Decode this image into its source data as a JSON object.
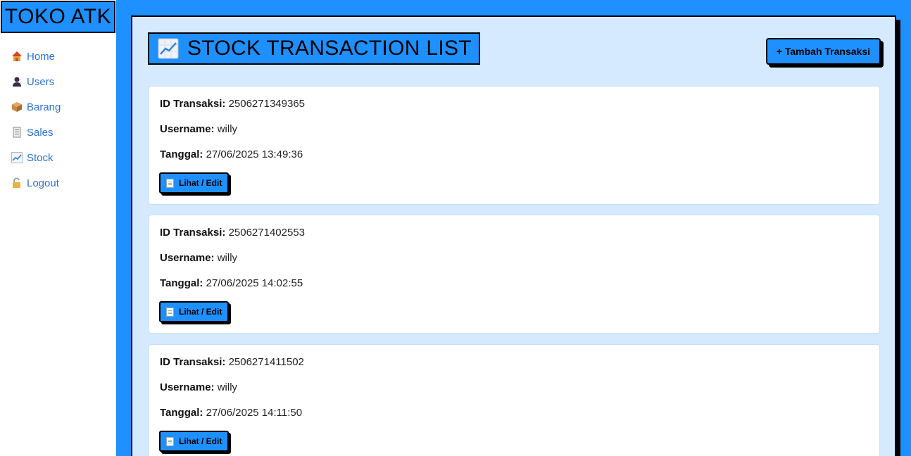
{
  "sidebar": {
    "brand": "TOKO ATK",
    "items": [
      {
        "label": "Home",
        "icon": "house-icon"
      },
      {
        "label": "Users",
        "icon": "user-icon"
      },
      {
        "label": "Barang",
        "icon": "package-icon"
      },
      {
        "label": "Sales",
        "icon": "receipt-icon"
      },
      {
        "label": "Stock",
        "icon": "chart-increasing-icon"
      },
      {
        "label": "Logout",
        "icon": "unlock-icon"
      }
    ]
  },
  "header": {
    "title": "STOCK TRANSACTION LIST",
    "title_icon": "chart-increasing-icon",
    "add_label": "+ Tambah Transaksi"
  },
  "labels": {
    "id": "ID Transaksi:",
    "username": "Username:",
    "date": "Tanggal:",
    "view": "Lihat / Edit"
  },
  "transactions": [
    {
      "id": "2506271349365",
      "username": "willy",
      "date": "27/06/2025 13:49:36"
    },
    {
      "id": "2506271402553",
      "username": "willy",
      "date": "27/06/2025 14:02:55"
    },
    {
      "id": "2506271411502",
      "username": "willy",
      "date": "27/06/2025 14:11:50"
    }
  ],
  "colors": {
    "accent": "#1e90ff",
    "panel": "#d6eaff",
    "link": "#2a72d6"
  }
}
